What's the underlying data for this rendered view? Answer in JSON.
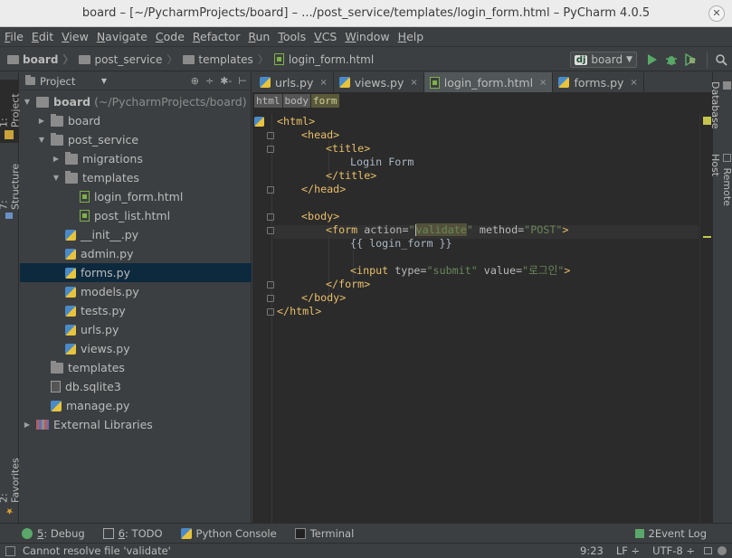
{
  "window": {
    "title": "board – [~/PycharmProjects/board] – .../post_service/templates/login_form.html – PyCharm 4.0.5",
    "close_symbol": "✕"
  },
  "menu": [
    {
      "u": "F",
      "rest": "ile"
    },
    {
      "u": "E",
      "rest": "dit"
    },
    {
      "u": "V",
      "rest": "iew"
    },
    {
      "u": "N",
      "rest": "avigate"
    },
    {
      "u": "C",
      "rest": "ode"
    },
    {
      "u": "R",
      "rest": "efactor"
    },
    {
      "u": "R",
      "rest": "un"
    },
    {
      "u": "T",
      "rest": "ools"
    },
    {
      "u": "V",
      "rest": "CS"
    },
    {
      "u": "W",
      "rest": "indow"
    },
    {
      "u": "H",
      "rest": "elp"
    }
  ],
  "breadcrumb": [
    "board",
    "post_service",
    "templates",
    "login_form.html"
  ],
  "run_config": {
    "badge": "dj",
    "name": "board"
  },
  "left_tabs": {
    "project": "1: Project",
    "structure": "7: Structure",
    "favorites": "2: Favorites"
  },
  "right_tabs": {
    "database": "Database",
    "remote_host": "Remote Host"
  },
  "project_panel": {
    "view_label": "Project",
    "tools": [
      "⊕",
      "÷",
      "✱-",
      "⊢"
    ]
  },
  "tree": [
    {
      "label": "board",
      "muted": " (~/PycharmProjects/board)",
      "depth": 0,
      "arrow": "▼",
      "icon": "proj",
      "bold": true
    },
    {
      "label": "board",
      "depth": 1,
      "arrow": "▶",
      "icon": "folder"
    },
    {
      "label": "post_service",
      "depth": 1,
      "arrow": "▼",
      "icon": "folder"
    },
    {
      "label": "migrations",
      "depth": 2,
      "arrow": "▶",
      "icon": "folder"
    },
    {
      "label": "templates",
      "depth": 2,
      "arrow": "▼",
      "icon": "folder"
    },
    {
      "label": "login_form.html",
      "depth": 3,
      "arrow": "",
      "icon": "html"
    },
    {
      "label": "post_list.html",
      "depth": 3,
      "arrow": "",
      "icon": "html"
    },
    {
      "label": "__init__.py",
      "depth": 2,
      "arrow": "",
      "icon": "py"
    },
    {
      "label": "admin.py",
      "depth": 2,
      "arrow": "",
      "icon": "py"
    },
    {
      "label": "forms.py",
      "depth": 2,
      "arrow": "",
      "icon": "py",
      "selected": true
    },
    {
      "label": "models.py",
      "depth": 2,
      "arrow": "",
      "icon": "py"
    },
    {
      "label": "tests.py",
      "depth": 2,
      "arrow": "",
      "icon": "py"
    },
    {
      "label": "urls.py",
      "depth": 2,
      "arrow": "",
      "icon": "py"
    },
    {
      "label": "views.py",
      "depth": 2,
      "arrow": "",
      "icon": "py"
    },
    {
      "label": "templates",
      "depth": 1,
      "arrow": "",
      "icon": "folder"
    },
    {
      "label": "db.sqlite3",
      "depth": 1,
      "arrow": "",
      "icon": "db"
    },
    {
      "label": "manage.py",
      "depth": 1,
      "arrow": "",
      "icon": "py"
    },
    {
      "label": "External Libraries",
      "depth": 0,
      "arrow": "▶",
      "icon": "lib"
    }
  ],
  "editor_tabs": [
    {
      "label": "urls.py",
      "icon": "py",
      "close": "×"
    },
    {
      "label": "views.py",
      "icon": "py",
      "close": "×"
    },
    {
      "label": "login_form.html",
      "icon": "html",
      "close": "×",
      "active": true
    },
    {
      "label": "forms.py",
      "icon": "py",
      "close": "×"
    }
  ],
  "editor_breadcrumbs": [
    "html",
    "body",
    "form"
  ],
  "code": {
    "l1": "<html>",
    "l2": "<head>",
    "l3": "<title>",
    "l4": "Login Form",
    "l5": "</title>",
    "l6": "</head>",
    "l8": "<body>",
    "l9_open": "<form",
    "l9_attr1": " action=",
    "l9_q1": "\"",
    "l9_val1": "validate",
    "l9_q2": "\"",
    "l9_attr2": " method=",
    "l9_val2": "\"POST\"",
    "l9_close": ">",
    "l10": "{{ login_form }}",
    "l12_open": "<input",
    "l12_attr1": " type=",
    "l12_val1": "\"submit\"",
    "l12_attr2": " value=",
    "l12_val2": "\"로그인\"",
    "l12_close": ">",
    "l13": "</form>",
    "l14": "</body>",
    "l15": "</html>"
  },
  "bottom_tabs": [
    {
      "num": "5",
      "label": ": Debug"
    },
    {
      "num": "6",
      "label": ": TODO"
    },
    {
      "num": "",
      "label": "Python Console"
    },
    {
      "num": "",
      "label": "Terminal"
    }
  ],
  "event_log": {
    "num": "2",
    "label": " Event Log"
  },
  "status": {
    "message": "Cannot resolve file 'validate'",
    "position": "9:23",
    "line_sep": "LF ÷",
    "encoding": "UTF-8 ÷"
  },
  "colors": {
    "accent_selected": "#0d293e",
    "run_green": "#59a869",
    "tag": "#e8bf6a",
    "string": "#6a8759"
  }
}
